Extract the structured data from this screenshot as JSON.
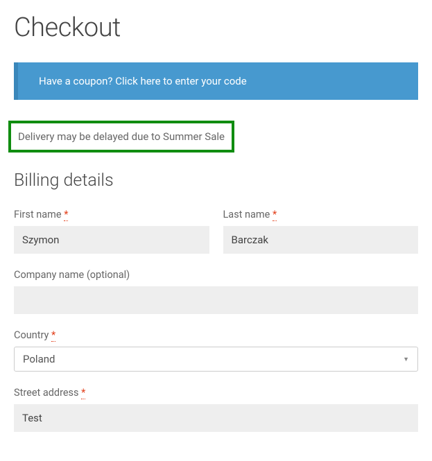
{
  "page": {
    "title": "Checkout"
  },
  "coupon": {
    "text": "Have a coupon? Click here to enter your code"
  },
  "notice": {
    "text": "Delivery may be delayed due to Summer Sale"
  },
  "billing": {
    "heading": "Billing details",
    "first_name": {
      "label": "First name",
      "value": "Szymon",
      "required_mark": "*"
    },
    "last_name": {
      "label": "Last name",
      "value": "Barczak",
      "required_mark": "*"
    },
    "company": {
      "label": "Company name (optional)",
      "value": ""
    },
    "country": {
      "label": "Country",
      "value": "Poland",
      "required_mark": "*"
    },
    "street": {
      "label": "Street address",
      "value": "Test",
      "required_mark": "*"
    }
  }
}
